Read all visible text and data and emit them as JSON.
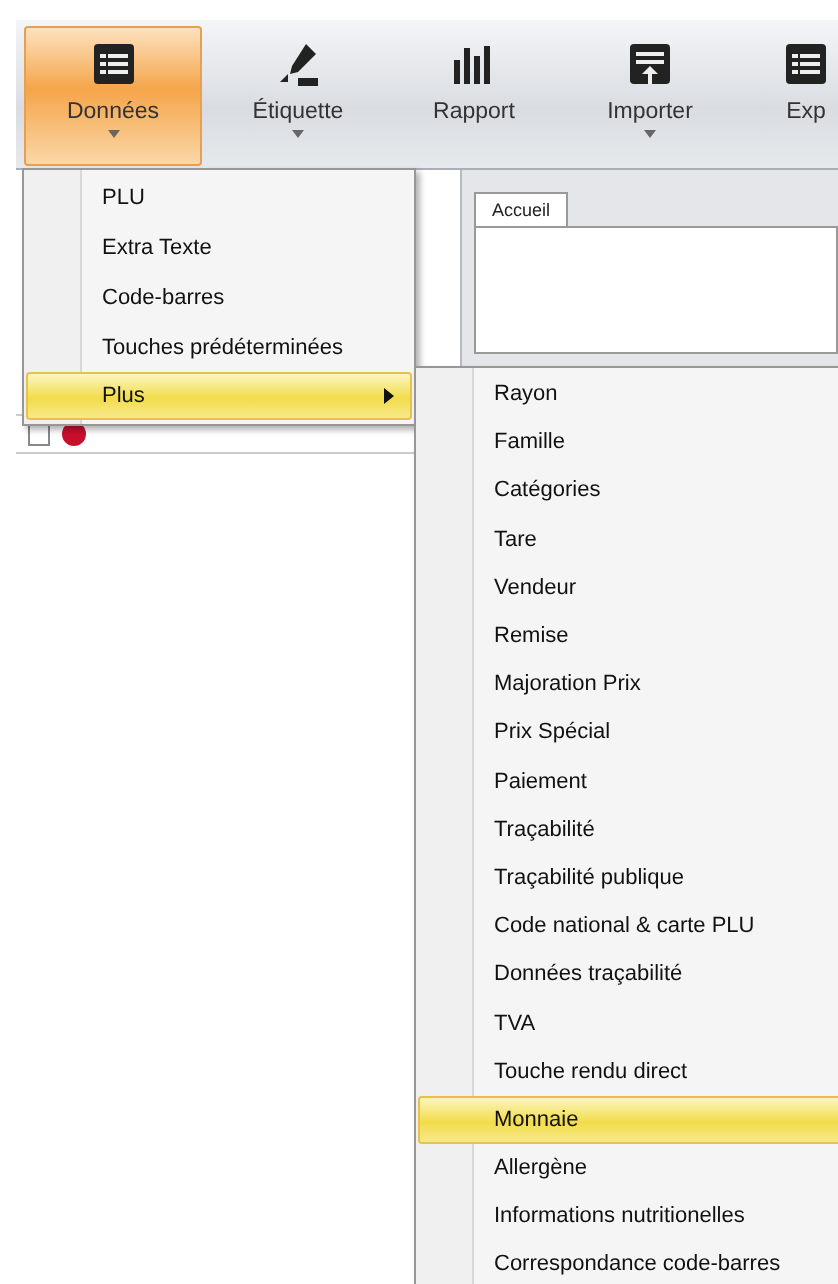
{
  "toolbar": [
    {
      "label": "Données",
      "kind": "table",
      "dropdown": true,
      "selected": true
    },
    {
      "label": "Étiquette",
      "kind": "marker",
      "dropdown": true,
      "selected": false
    },
    {
      "label": "Rapport",
      "kind": "bars",
      "dropdown": false,
      "selected": false
    },
    {
      "label": "Importer",
      "kind": "import",
      "dropdown": true,
      "selected": false
    },
    {
      "label": "Exp",
      "kind": "table",
      "dropdown": false,
      "selected": false
    }
  ],
  "tabs": [
    {
      "label": "Accueil",
      "selected": true
    }
  ],
  "list_row": {
    "checked": false,
    "color": "#c8102e"
  },
  "menu": {
    "items": [
      {
        "label": "PLU",
        "selected": false,
        "submenu": false
      },
      {
        "label": "Extra Texte",
        "selected": false,
        "submenu": false
      },
      {
        "label": "Code-barres",
        "selected": false,
        "submenu": false
      },
      {
        "label": "Touches prédéterminées",
        "selected": false,
        "submenu": false
      },
      {
        "label": "Plus",
        "selected": true,
        "submenu": true
      }
    ]
  },
  "submenu": {
    "items": [
      {
        "label": "Rayon",
        "selected": false
      },
      {
        "label": "Famille",
        "selected": false
      },
      {
        "label": "Catégories",
        "selected": false
      },
      {
        "label": "Tare",
        "selected": false
      },
      {
        "label": "Vendeur",
        "selected": false
      },
      {
        "label": "Remise",
        "selected": false
      },
      {
        "label": "Majoration Prix",
        "selected": false
      },
      {
        "label": "Prix Spécial",
        "selected": false
      },
      {
        "label": "Paiement",
        "selected": false
      },
      {
        "label": "Traçabilité",
        "selected": false
      },
      {
        "label": "Traçabilité publique",
        "selected": false
      },
      {
        "label": "Code national & carte PLU",
        "selected": false
      },
      {
        "label": "Données traçabilité",
        "selected": false
      },
      {
        "label": "TVA",
        "selected": false
      },
      {
        "label": "Touche rendu direct",
        "selected": false
      },
      {
        "label": "Monnaie",
        "selected": true
      },
      {
        "label": "Allergène",
        "selected": false
      },
      {
        "label": "Informations nutritionelles",
        "selected": false
      },
      {
        "label": "Correspondance code-barres",
        "selected": false
      }
    ]
  }
}
